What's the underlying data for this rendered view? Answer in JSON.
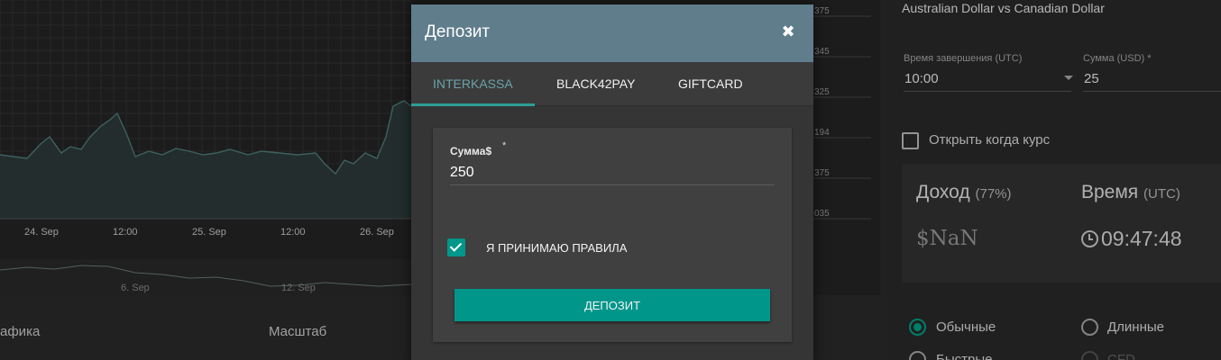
{
  "chart": {
    "x_ticks": [
      "24. Sep",
      "12:00",
      "25. Sep",
      "12:00",
      "26. Sep"
    ],
    "y_ticks": [
      "375",
      "345",
      "325",
      "194",
      "375",
      "035"
    ],
    "navigator_labels": [
      "6. Sep",
      "12. Sep"
    ]
  },
  "bottom_bar": {
    "chart_type_label": "афика",
    "scale_label": "Масштаб"
  },
  "trade_panel": {
    "pair_title": "Australian Dollar vs Canadian Dollar",
    "expiry_label": "Время завершения (UTC)",
    "expiry_value": "10:00",
    "amount_label": "Сумма (USD) *",
    "amount_value": "25",
    "open_when_rate_label": "Открыть когда курс",
    "profit_title": "Доход",
    "profit_percent": "(77%)",
    "profit_value": "$NaN",
    "time_title": "Время",
    "time_zone": "(UTC)",
    "time_value": "09:47:48",
    "options": [
      {
        "label": "Обычные",
        "selected": true
      },
      {
        "label": "Длинные",
        "selected": false
      },
      {
        "label": "Быстрые",
        "selected": false
      },
      {
        "label": "CFD",
        "selected": false
      }
    ]
  },
  "modal": {
    "title": "Депозит",
    "close_glyph": "✖",
    "tabs": [
      {
        "label": "INTERKASSA",
        "active": true
      },
      {
        "label": "BLACK42PAY",
        "active": false
      },
      {
        "label": "GIFTCARD",
        "active": false
      }
    ],
    "amount_label": "Сумма$",
    "amount_required": "*",
    "amount_value": "250",
    "agree_label": "Я ПРИНИМАЮ ПРАВИЛА",
    "agree_checked": true,
    "submit_label": "ДЕПОЗИТ"
  },
  "colors": {
    "accent": "#00968a",
    "modal_header": "#5f7d8b",
    "active_tab": "#6aa3a8"
  }
}
